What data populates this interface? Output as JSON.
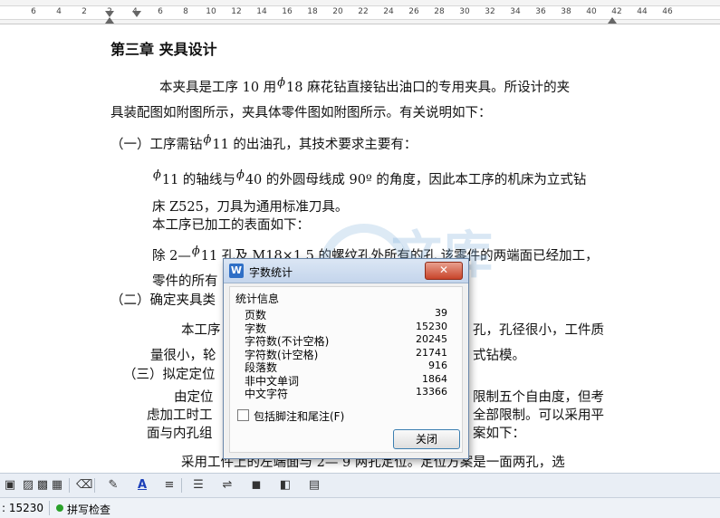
{
  "ruler": {
    "numbers": [
      "6",
      "4",
      "2",
      "2",
      "4",
      "6",
      "8",
      "10",
      "12",
      "14",
      "16",
      "18",
      "20",
      "22",
      "24",
      "26",
      "28",
      "30",
      "32",
      "34",
      "36",
      "38",
      "40",
      "42",
      "44",
      "46"
    ]
  },
  "document": {
    "chapter_title": "第三章  夹具设计",
    "phi_symbol": "ϕ",
    "lines": {
      "p1a_pre": "本夹具是工序 10 用",
      "p1a_post": "18 麻花钻直接钻出油口的专用夹具。所设计的夹",
      "p1b": "具装配图如附图所示，夹具体零件图如附图所示。有关说明如下：",
      "s1": "（一）工序需钻",
      "s1_post": "11 的出油孔，其技术要求主要有：",
      "r1_mid": "11 的轴线与",
      "r1_post": "40 的外圆母线成 90º 的角度，因此本工序的机床为立式钻",
      "r2": "床 Z525，刀具为通用标准刀具。",
      "r3": "本工序已加工的表面如下：",
      "r4_pre": "除 2—",
      "r4_post": "11 孔及 M18×1.5 的螺纹孔外所有的孔  该零件的两端面已经加工，",
      "r5": "零件的所有",
      "s2": "（二）确定夹具类",
      "t1a": "本工序",
      "t1b": "孔，孔径很小，工件质",
      "t2a": "量很小，轮",
      "t2b": "式钻模。",
      "s3": "（三）拟定定位",
      "u1a": "由定位",
      "u1b": "限制五个自由度，但考",
      "u2a": "虑加工时工",
      "u2b": "全部限制。可以采用平",
      "u3a": "面与内孔组",
      "u3b": "案如下：",
      "u4": "采用工件上的左端面与 2—   9 两孔定位。定位方案是一面两孔，选"
    }
  },
  "watermark": {
    "text": "文库",
    "url": "renrendoc.com"
  },
  "dialog": {
    "title": "字数统计",
    "app_icon": "W",
    "close_glyph": "✕",
    "group_label": "统计信息",
    "stats": [
      {
        "label": "页数",
        "value": "39"
      },
      {
        "label": "字数",
        "value": "15230"
      },
      {
        "label": "字符数(不计空格)",
        "value": "20245"
      },
      {
        "label": "字符数(计空格)",
        "value": "21741"
      },
      {
        "label": "段落数",
        "value": "916"
      },
      {
        "label": "非中文单词",
        "value": "1864"
      },
      {
        "label": "中文字符",
        "value": "13366"
      }
    ],
    "include_footnotes_label": "包括脚注和尾注(F)",
    "close_button": "关闭"
  },
  "toolbar": {
    "icons": [
      "▣",
      "▨",
      "▩",
      "▦",
      "⌫",
      "✎",
      "A",
      "≡",
      "☰",
      "⇌",
      "◼",
      "◧",
      "▤"
    ]
  },
  "status": {
    "word_count": ": 15230",
    "spell_check": "拼写检查"
  },
  "colors": {
    "dialog_titlebar": "#c4d5ec",
    "close_red": "#c8442a",
    "spell_dot": "#2aa12a"
  }
}
